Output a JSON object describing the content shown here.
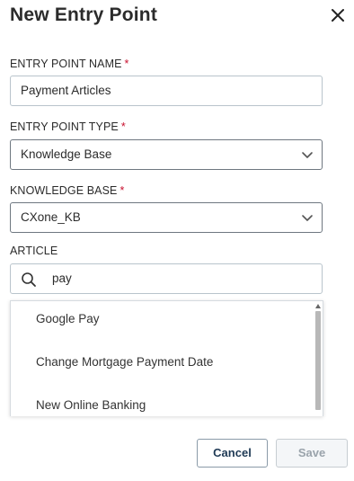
{
  "dialog": {
    "title": "New Entry Point",
    "close_icon": "close-icon"
  },
  "fields": {
    "name": {
      "label": "ENTRY POINT NAME",
      "required_mark": "*",
      "value": "Payment Articles"
    },
    "type": {
      "label": "ENTRY POINT TYPE",
      "required_mark": "*",
      "value": "Knowledge Base",
      "icon": "chevron-down-icon"
    },
    "knowledge_base": {
      "label": "KNOWLEDGE BASE",
      "required_mark": "*",
      "value": "CXone_KB",
      "icon": "chevron-down-icon"
    },
    "article": {
      "label": "ARTICLE",
      "value": "pay",
      "icon": "search-icon"
    }
  },
  "dropdown": {
    "options": [
      {
        "label": "Google Pay"
      },
      {
        "label": "Change Mortgage Payment Date"
      },
      {
        "label": "New Online Banking"
      }
    ]
  },
  "actions": {
    "cancel_label": "Cancel",
    "save_label": "Save"
  },
  "colors": {
    "required": "#c8102e",
    "cancel_text": "#1f3a55",
    "save_disabled_text": "#9aa3ab"
  }
}
